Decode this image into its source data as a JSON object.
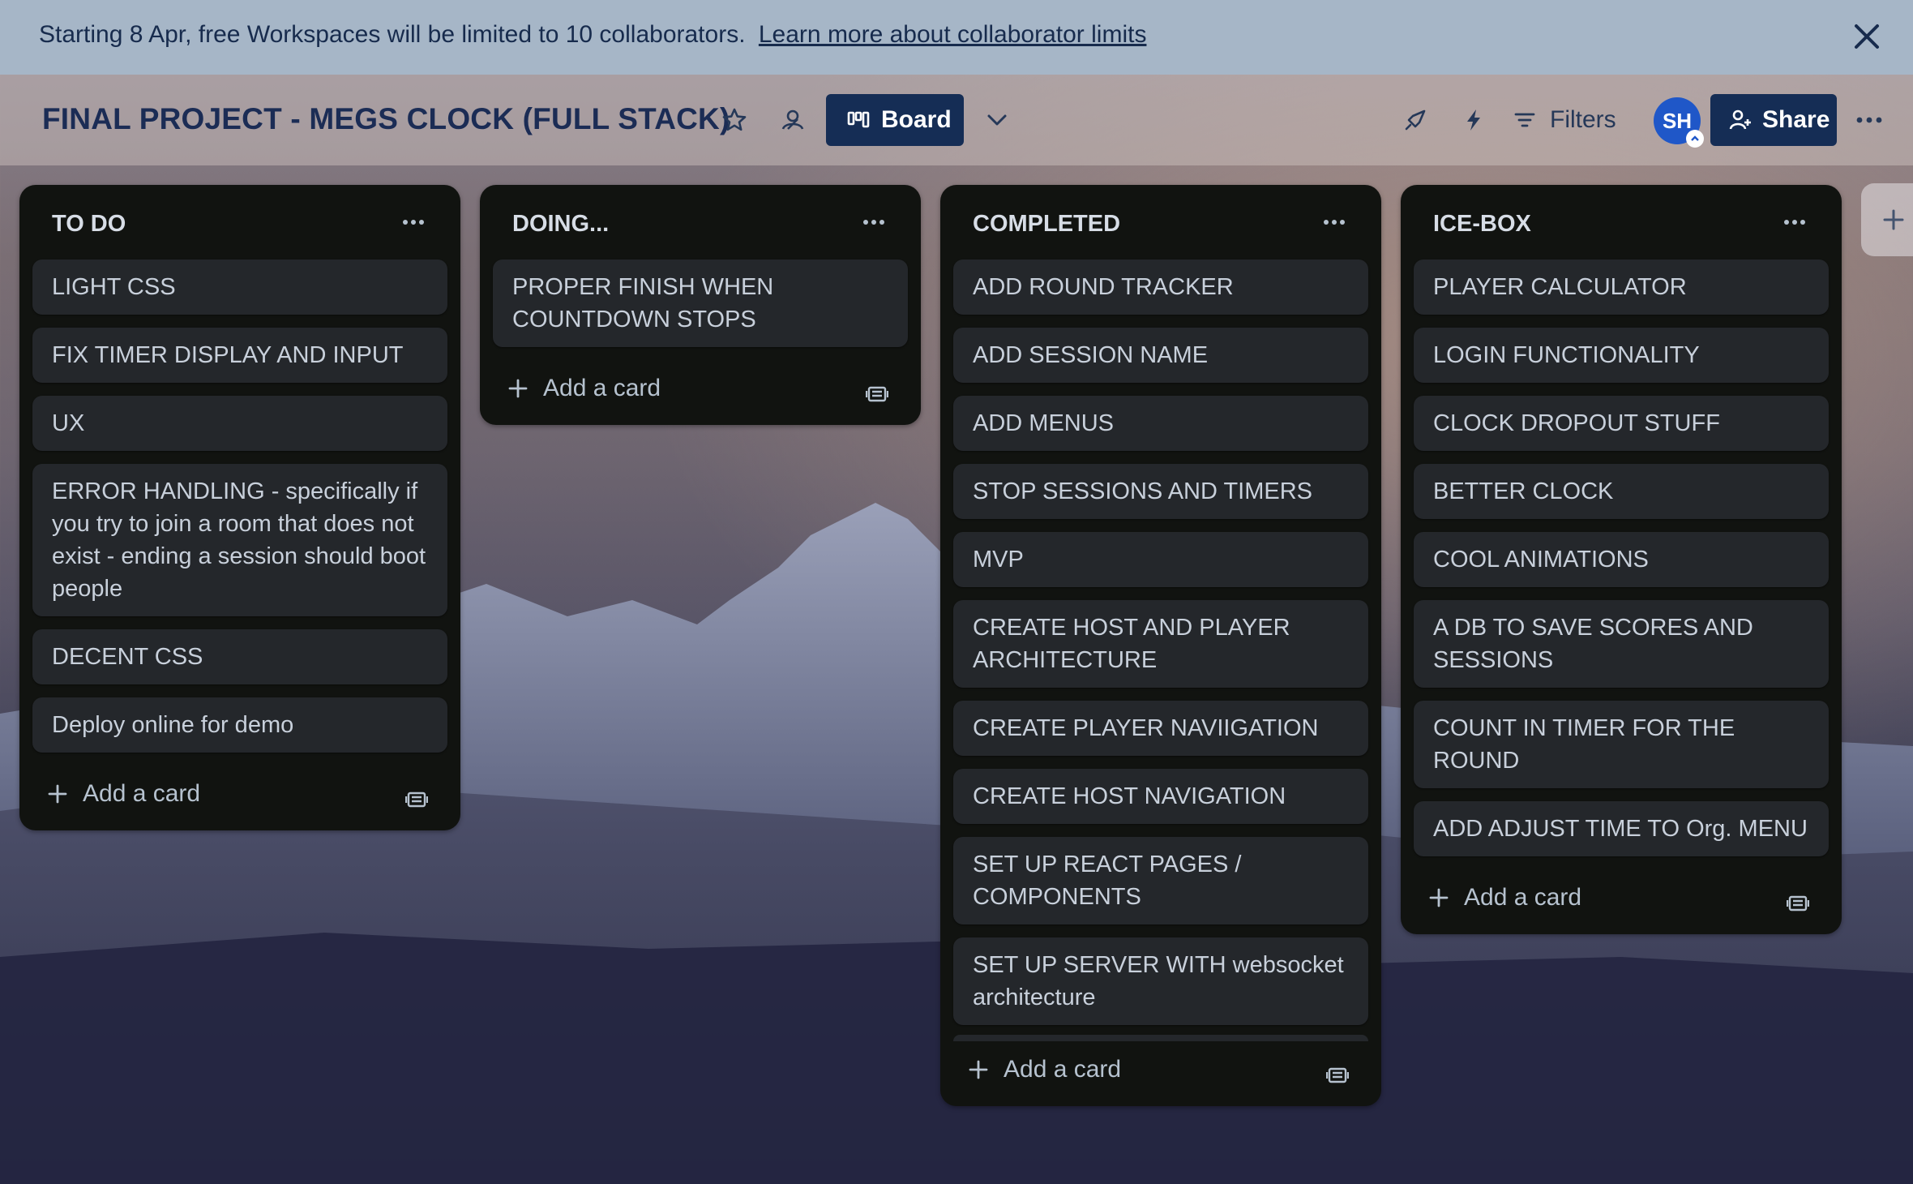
{
  "banner": {
    "text": "Starting 8 Apr, free Workspaces will be limited to 10 collaborators.",
    "link": "Learn more about collaborator limits"
  },
  "header": {
    "title": "FINAL PROJECT - MEGS CLOCK (FULL STACK)",
    "view_label": "Board",
    "filters_label": "Filters",
    "avatar_initials": "SH",
    "share_label": "Share"
  },
  "lists": [
    {
      "title": "TO DO",
      "cards": [
        "LIGHT CSS",
        "FIX TIMER DISPLAY AND INPUT",
        "UX",
        "ERROR HANDLING - specifically if you try to join a room that does not exist - ending a session should boot people",
        "DECENT CSS",
        "Deploy online for demo"
      ],
      "add_label": "Add a card"
    },
    {
      "title": "DOING...",
      "cards": [
        "PROPER FINISH WHEN COUNTDOWN STOPS"
      ],
      "add_label": "Add a card"
    },
    {
      "title": "COMPLETED",
      "cards": [
        "ADD ROUND TRACKER",
        "ADD SESSION NAME",
        "ADD MENUS",
        "STOP SESSIONS AND TIMERS",
        "MVP",
        "CREATE HOST AND PLAYER ARCHITECTURE",
        "CREATE PLAYER NAVIIGATION",
        "CREATE HOST NAVIGATION",
        "SET UP REACT PAGES / COMPONENTS",
        "SET UP SERVER WITH websocket architecture"
      ],
      "add_label": "Add a card"
    },
    {
      "title": "ICE-BOX",
      "cards": [
        "PLAYER CALCULATOR",
        "LOGIN FUNCTIONALITY",
        "CLOCK DROPOUT STUFF",
        "BETTER CLOCK",
        "COOL ANIMATIONS",
        "A DB TO SAVE SCORES AND SESSIONS",
        "COUNT IN TIMER FOR THE ROUND",
        "ADD ADJUST TIME TO Org. MENU"
      ],
      "add_label": "Add a card"
    }
  ],
  "colors": {
    "banner_bg": "#a6b6c7",
    "button_bg": "#152d55",
    "list_bg": "#111310",
    "card_bg": "#24272b",
    "avatar_bg": "#1f57c8"
  },
  "icons": [
    "close-icon",
    "star-icon",
    "workspace-visible-icon",
    "board-icon",
    "chevron-down-icon",
    "power-ups-icon",
    "automation-icon",
    "filter-icon",
    "add-member-icon",
    "more-icon",
    "plus-icon",
    "template-icon"
  ]
}
